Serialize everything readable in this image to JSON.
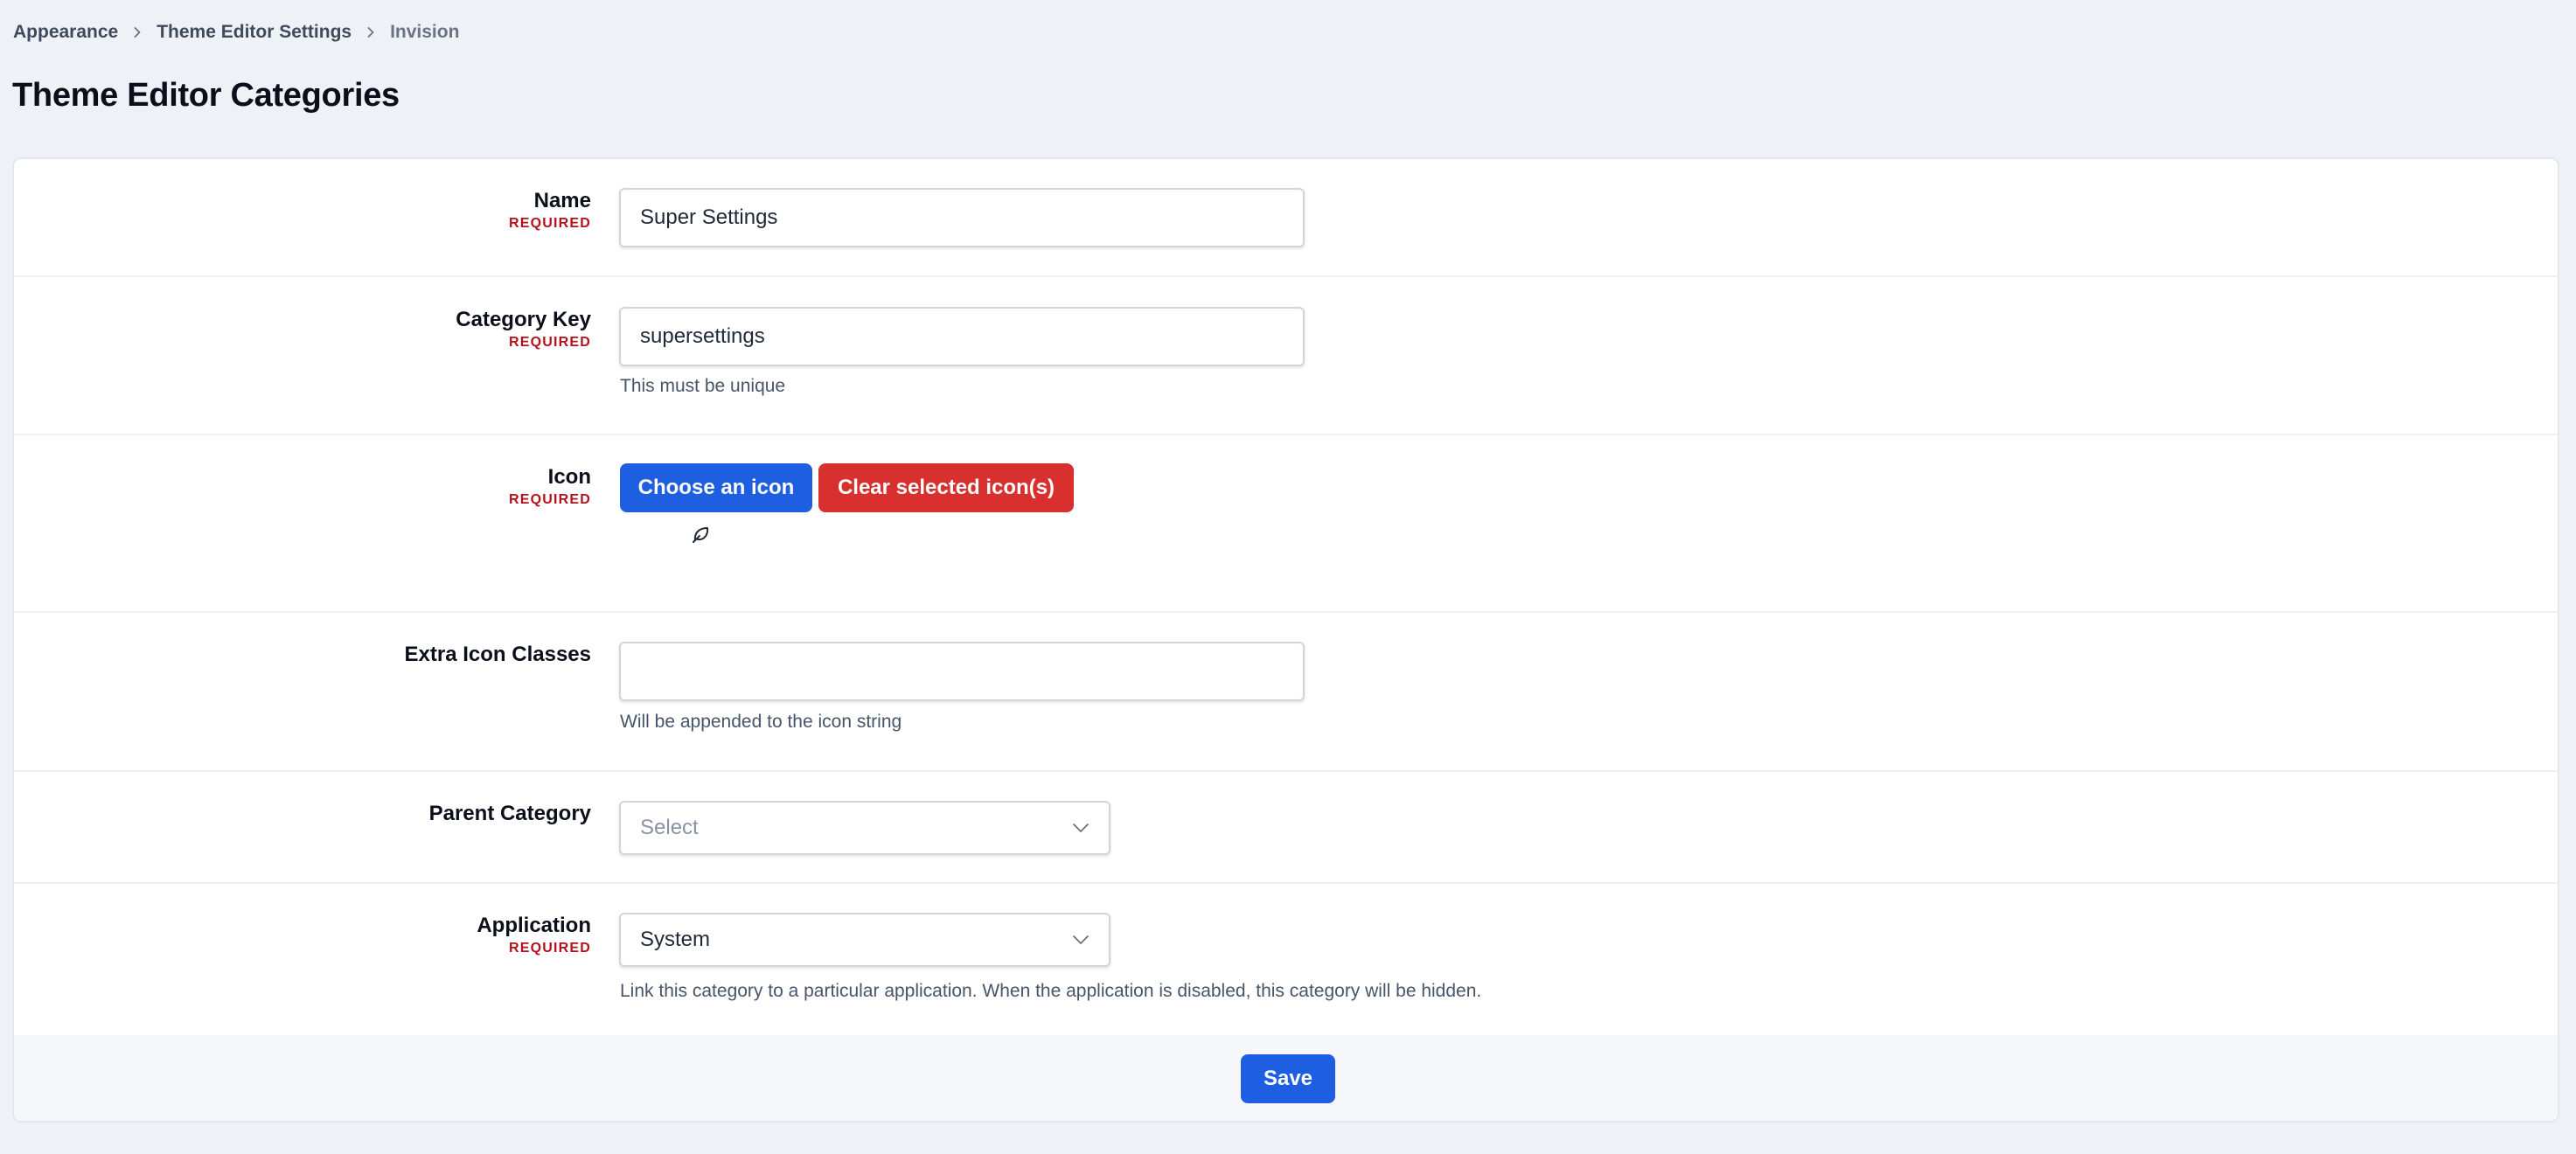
{
  "breadcrumb": {
    "items": [
      "Appearance",
      "Theme Editor Settings"
    ],
    "current": "Invision"
  },
  "page": {
    "title": "Theme Editor Categories"
  },
  "form": {
    "required_label": "REQUIRED",
    "name": {
      "label": "Name",
      "value": "Super Settings"
    },
    "category_key": {
      "label": "Category Key",
      "value": "supersettings",
      "hint": "This must be unique"
    },
    "icon": {
      "label": "Icon",
      "choose_label": "Choose an icon",
      "clear_label": "Clear selected icon(s)",
      "selected_icon": "leaf-icon"
    },
    "extra_icon_classes": {
      "label": "Extra Icon Classes",
      "value": "",
      "hint": "Will be appended to the icon string"
    },
    "parent_category": {
      "label": "Parent Category",
      "placeholder": "Select"
    },
    "application": {
      "label": "Application",
      "value": "System",
      "hint": "Link this category to a particular application. When the application is disabled, this category will be hidden."
    },
    "save_label": "Save"
  },
  "colors": {
    "primary": "#1d5fe0",
    "danger": "#d8302e",
    "required": "#b3121d",
    "background": "#eef1f6"
  }
}
